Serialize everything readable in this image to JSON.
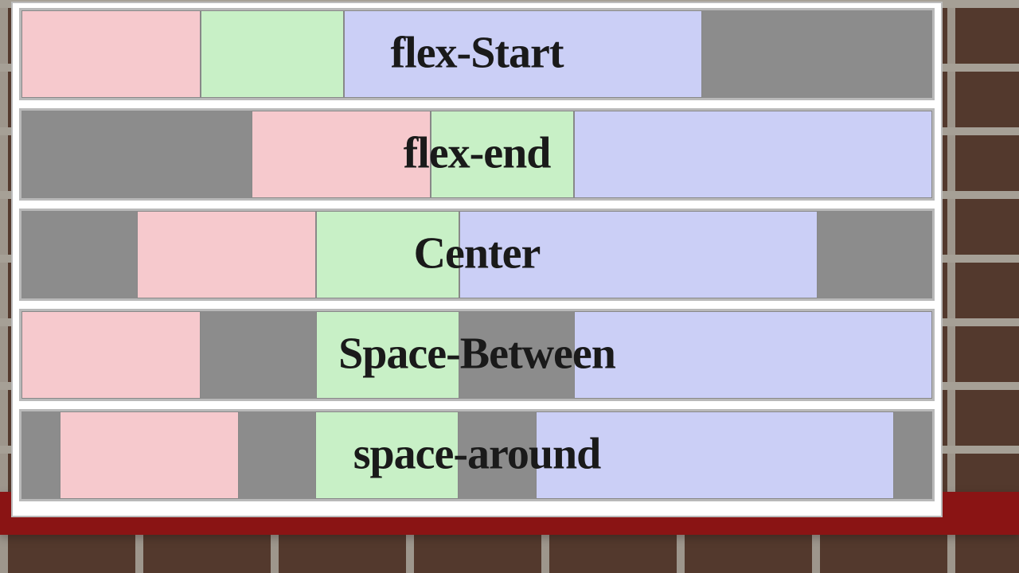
{
  "diagram": {
    "rows": [
      {
        "label": "flex-Start",
        "justify": "flex-start"
      },
      {
        "label": "flex-end",
        "justify": "flex-end"
      },
      {
        "label": "Center",
        "justify": "center"
      },
      {
        "label": "Space-Between",
        "justify": "space-between"
      },
      {
        "label": "space-around",
        "justify": "space-around"
      }
    ],
    "colors": {
      "box1": "#f6c9cd",
      "box2": "#c8f0c6",
      "box3": "#cbcff6",
      "track": "#8c8c8c"
    }
  }
}
